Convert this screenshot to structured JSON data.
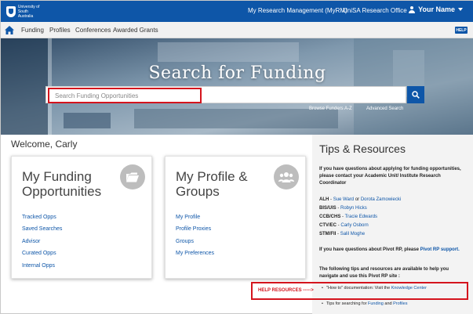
{
  "header": {
    "logo_text": "University of\nSouth Australia",
    "links": [
      "My Research Management (MyRM)",
      "UniSA Research Office"
    ],
    "user_name": "Your Name"
  },
  "nav": {
    "items": [
      "Funding",
      "Profiles",
      "Conferences",
      "Awarded Grants"
    ],
    "help_label": "HELP"
  },
  "hero": {
    "title": "Search for Funding",
    "search_placeholder": "Search Funding Opportunities",
    "links": [
      "Browse Funders A-Z",
      "Advanced Search"
    ]
  },
  "welcome": "Welcome, Carly",
  "cards": [
    {
      "title": "My Funding\nOpportunities",
      "icon": "folder-icon",
      "links": [
        "Tracked Opps",
        "Saved Searches",
        "Advisor",
        "Curated Opps",
        "Internal Opps"
      ]
    },
    {
      "title": "My Profile &\nGroups",
      "icon": "group-icon",
      "links": [
        "My Profile",
        "Profile Proxies",
        "Groups",
        "My Preferences"
      ]
    }
  ],
  "tips": {
    "title": "Tips & Resources",
    "intro": "If you have questions about applying for funding opportunities, please contact your Academic Unit/ Institute Research Coordinator",
    "contacts": [
      {
        "unit": "ALH",
        "sep": " - ",
        "name": "Sue Ward",
        "joiner": " or ",
        "name2": "Dorota Zamowiecki"
      },
      {
        "unit": "BIS/UIS",
        "sep": " - ",
        "name": "Robyn Hicks",
        "joiner": "",
        "name2": ""
      },
      {
        "unit": "CCB/CHS",
        "sep": " - ",
        "name": "Tracie Edwards",
        "joiner": "",
        "name2": ""
      },
      {
        "unit": "CTV/EC",
        "sep": " - ",
        "name": "Carly Osborn",
        "joiner": "",
        "name2": ""
      },
      {
        "unit": "STM/FII",
        "sep": " - ",
        "name": "Salil Moghe",
        "joiner": "",
        "name2": ""
      }
    ],
    "pivot_text": "If you have questions about Pivot RP, please",
    "pivot_link": "Pivot RP support.",
    "following_text": "The following tips and resources are available to help you navigate and use this Pivot RP site :",
    "bullets": [
      {
        "text": "\"How to\" documentation: Visit the ",
        "link": "Knowledge Center",
        "text2": "",
        "link2": ""
      },
      {
        "text": "Tips for searching for ",
        "link": "Funding",
        "text2": " and ",
        "link2": "Profiles"
      }
    ]
  },
  "help_resources_label": "HELP RESOURCES ----->",
  "colors": {
    "brand_blue": "#0e56a8",
    "highlight_red": "#d4141d"
  }
}
